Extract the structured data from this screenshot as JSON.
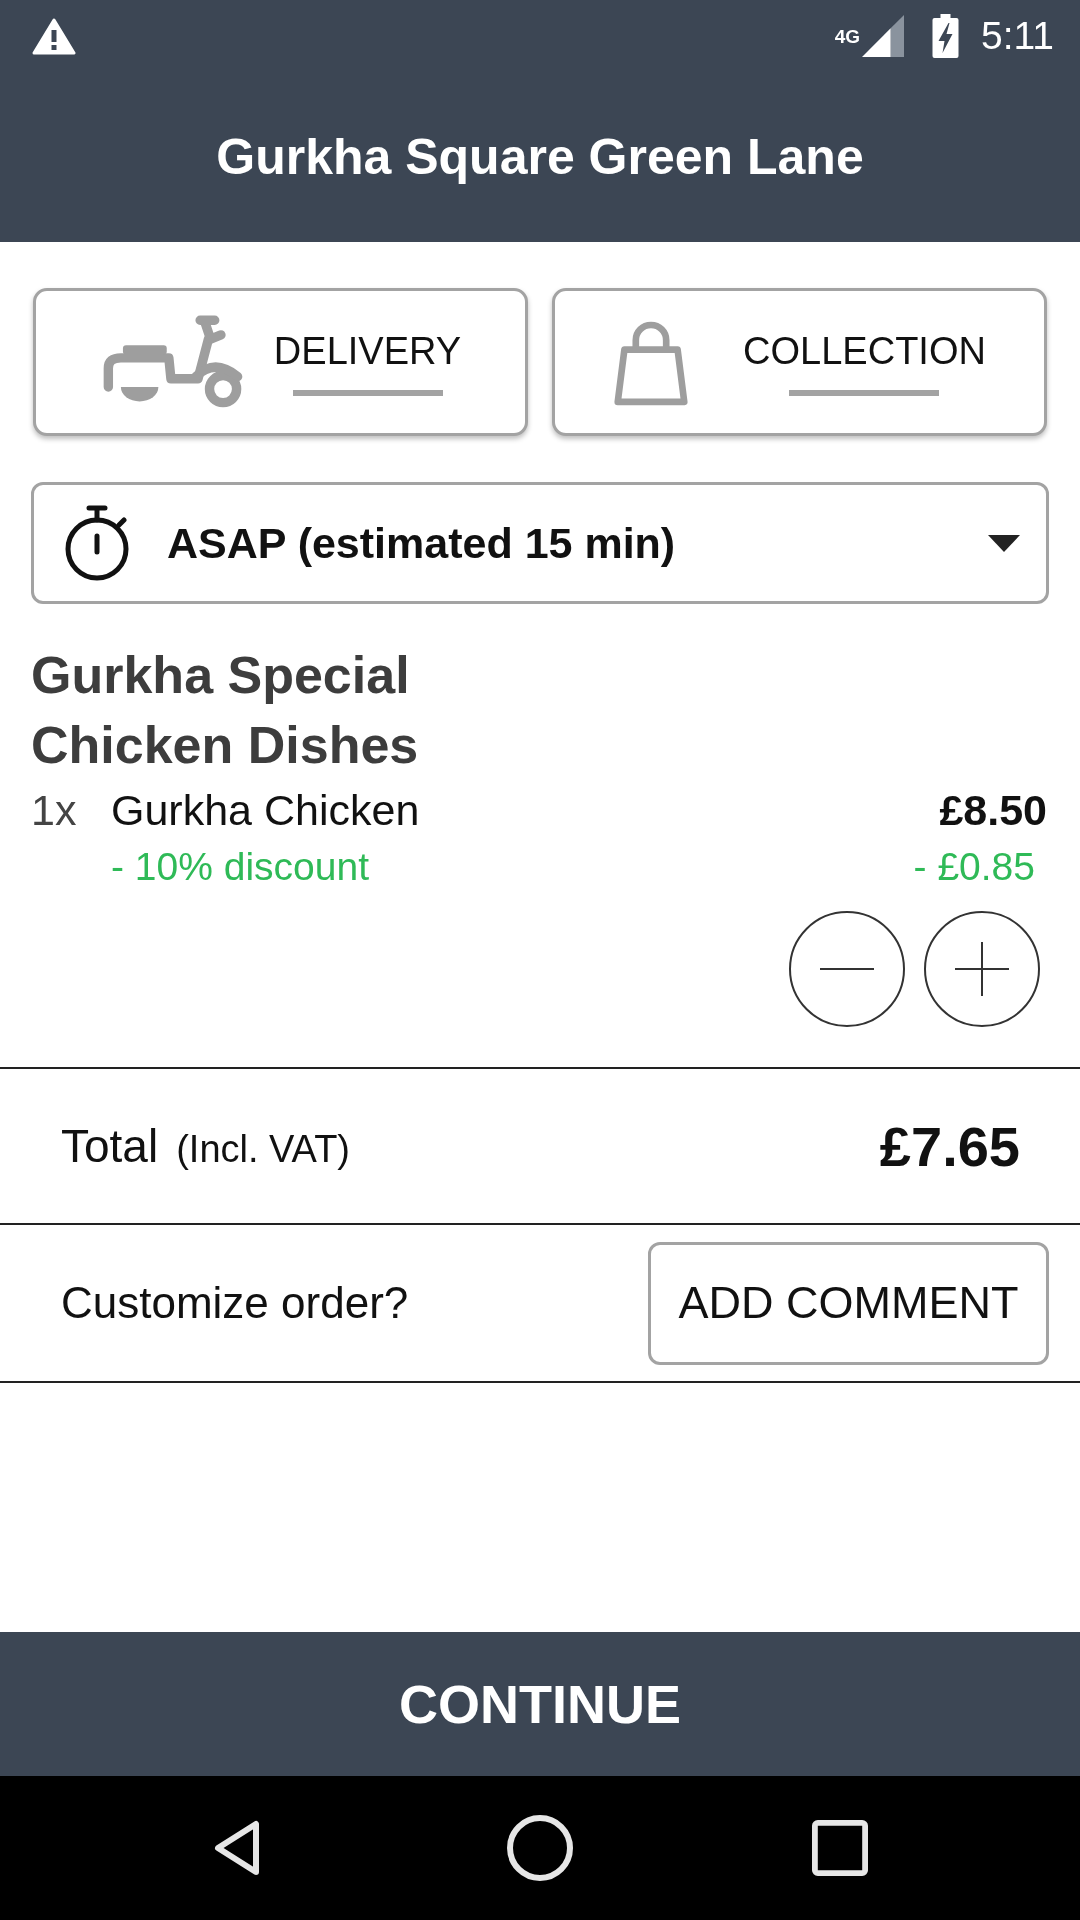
{
  "status_bar": {
    "network": "4G",
    "time": "5:11"
  },
  "header": {
    "title": "Gurkha Square Green Lane"
  },
  "order_types": [
    {
      "kind": "delivery",
      "label": "DELIVERY",
      "selected": false
    },
    {
      "kind": "collection",
      "label": "COLLECTION",
      "selected": false
    }
  ],
  "time_select": {
    "value": "ASAP (estimated 15 min)"
  },
  "category": {
    "title": "Gurkha Special Chicken Dishes",
    "items": [
      {
        "quantity": "1x",
        "name": "Gurkha Chicken",
        "price": "£8.50",
        "discount": {
          "label": "- 10% discount",
          "amount": "- £0.85"
        }
      }
    ]
  },
  "total": {
    "label": "Total",
    "note": "(Incl. VAT)",
    "amount": "£7.65"
  },
  "customize": {
    "prompt": "Customize order?",
    "button": "ADD COMMENT"
  },
  "continue_button": {
    "label": "CONTINUE"
  }
}
